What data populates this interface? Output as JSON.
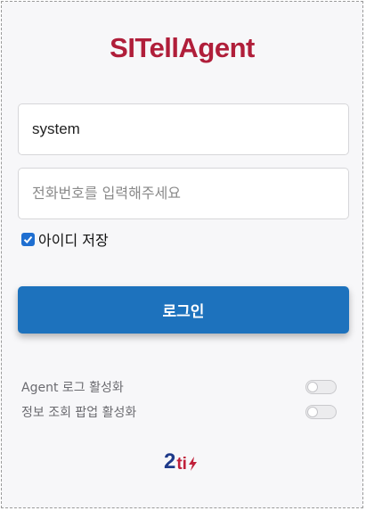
{
  "app": {
    "title": "SITellAgent"
  },
  "login": {
    "user_value": "system",
    "user_placeholder": "",
    "phone_value": "",
    "phone_placeholder": "전화번호를 입력해주세요",
    "remember_label": "아이디 저장",
    "remember_checked": true,
    "button_label": "로그인"
  },
  "options": [
    {
      "label": "Agent 로그 활성화",
      "enabled": false
    },
    {
      "label": "정보 조회 팝업 활성화",
      "enabled": false
    }
  ],
  "footer": {
    "logo_text_main": "2",
    "logo_text_accent": "ti",
    "logo_icon": "lightning-bolt-icon"
  },
  "colors": {
    "brand_red": "#b01e3a",
    "button_blue": "#1d72bd",
    "checkbox_blue": "#1f6fd1",
    "logo_navy": "#1e3a8a"
  }
}
